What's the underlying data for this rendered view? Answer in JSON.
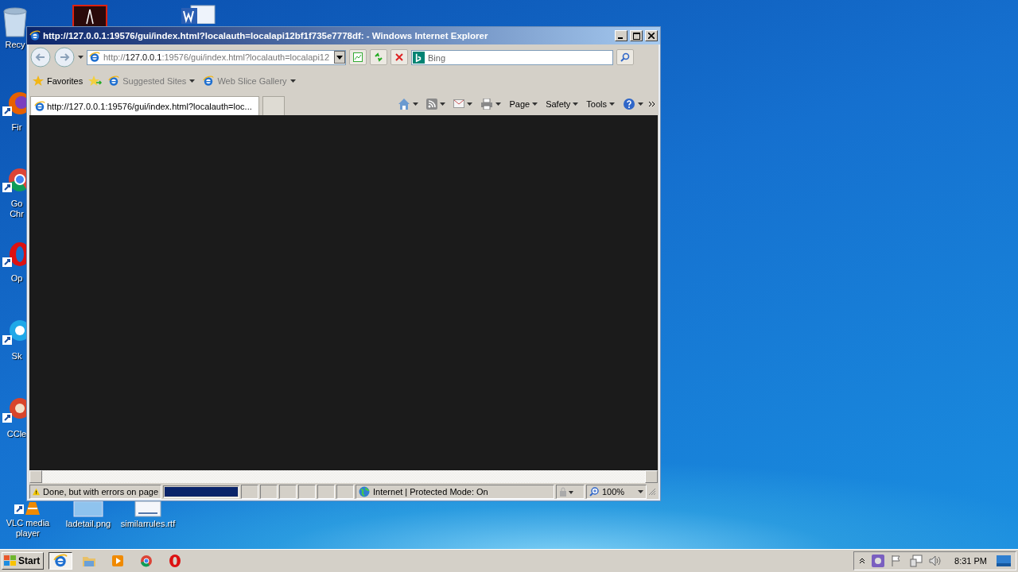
{
  "desktop": {
    "icons": [
      {
        "kind": "recycle",
        "label": "Recy"
      },
      {
        "kind": "pdf"
      },
      {
        "kind": "word"
      },
      {
        "kind": "firefox",
        "label": "Fir"
      },
      {
        "kind": "chrome",
        "label": "Go\nChr"
      },
      {
        "kind": "opera",
        "label": "Op"
      },
      {
        "kind": "skype",
        "label": "Sk"
      },
      {
        "kind": "ccleaner",
        "label": "CCle"
      },
      {
        "kind": "vlc",
        "label": "VLC media\nplayer"
      },
      {
        "kind": "image",
        "label": "ladetail.png"
      },
      {
        "kind": "rtf",
        "label": "similarrules.rtf"
      }
    ]
  },
  "window": {
    "title": "http://127.0.0.1:19576/gui/index.html?localauth=localapi12bf1f735e7778df: - Windows Internet Explorer",
    "address": {
      "scheme": "http://",
      "host": "127.0.0.1",
      "rest": ":19576/gui/index.html?localauth=localapi12"
    },
    "search": {
      "placeholder": "Bing"
    },
    "favorites": [
      {
        "kind": "star",
        "label": "Favorites"
      },
      {
        "kind": "site",
        "label": "Suggested Sites"
      },
      {
        "kind": "site",
        "label": "Web Slice Gallery"
      }
    ],
    "tabs": [
      {
        "label": "http://127.0.0.1:19576/gui/index.html?localauth=loc...",
        "selected": true
      }
    ],
    "commands": [
      {
        "kind": "home"
      },
      {
        "kind": "feed"
      },
      {
        "kind": "mail"
      },
      {
        "kind": "print"
      },
      {
        "kind": "text",
        "label": "Page"
      },
      {
        "kind": "text",
        "label": "Safety"
      },
      {
        "kind": "text",
        "label": "Tools"
      },
      {
        "kind": "help"
      }
    ],
    "status_bar": {
      "message": "Done, but with errors on page",
      "progress": {
        "level": 1
      },
      "zone": "Internet | Protected Mode: On",
      "zoom": "100%"
    }
  },
  "taskbar": {
    "start": "Start",
    "apps": [
      {
        "kind": "ie",
        "selected": true
      },
      {
        "kind": "folder",
        "selected": false
      },
      {
        "kind": "media",
        "selected": false
      },
      {
        "kind": "chrome",
        "selected": false
      },
      {
        "kind": "opera",
        "selected": false
      }
    ],
    "clock": "8:31 PM"
  }
}
